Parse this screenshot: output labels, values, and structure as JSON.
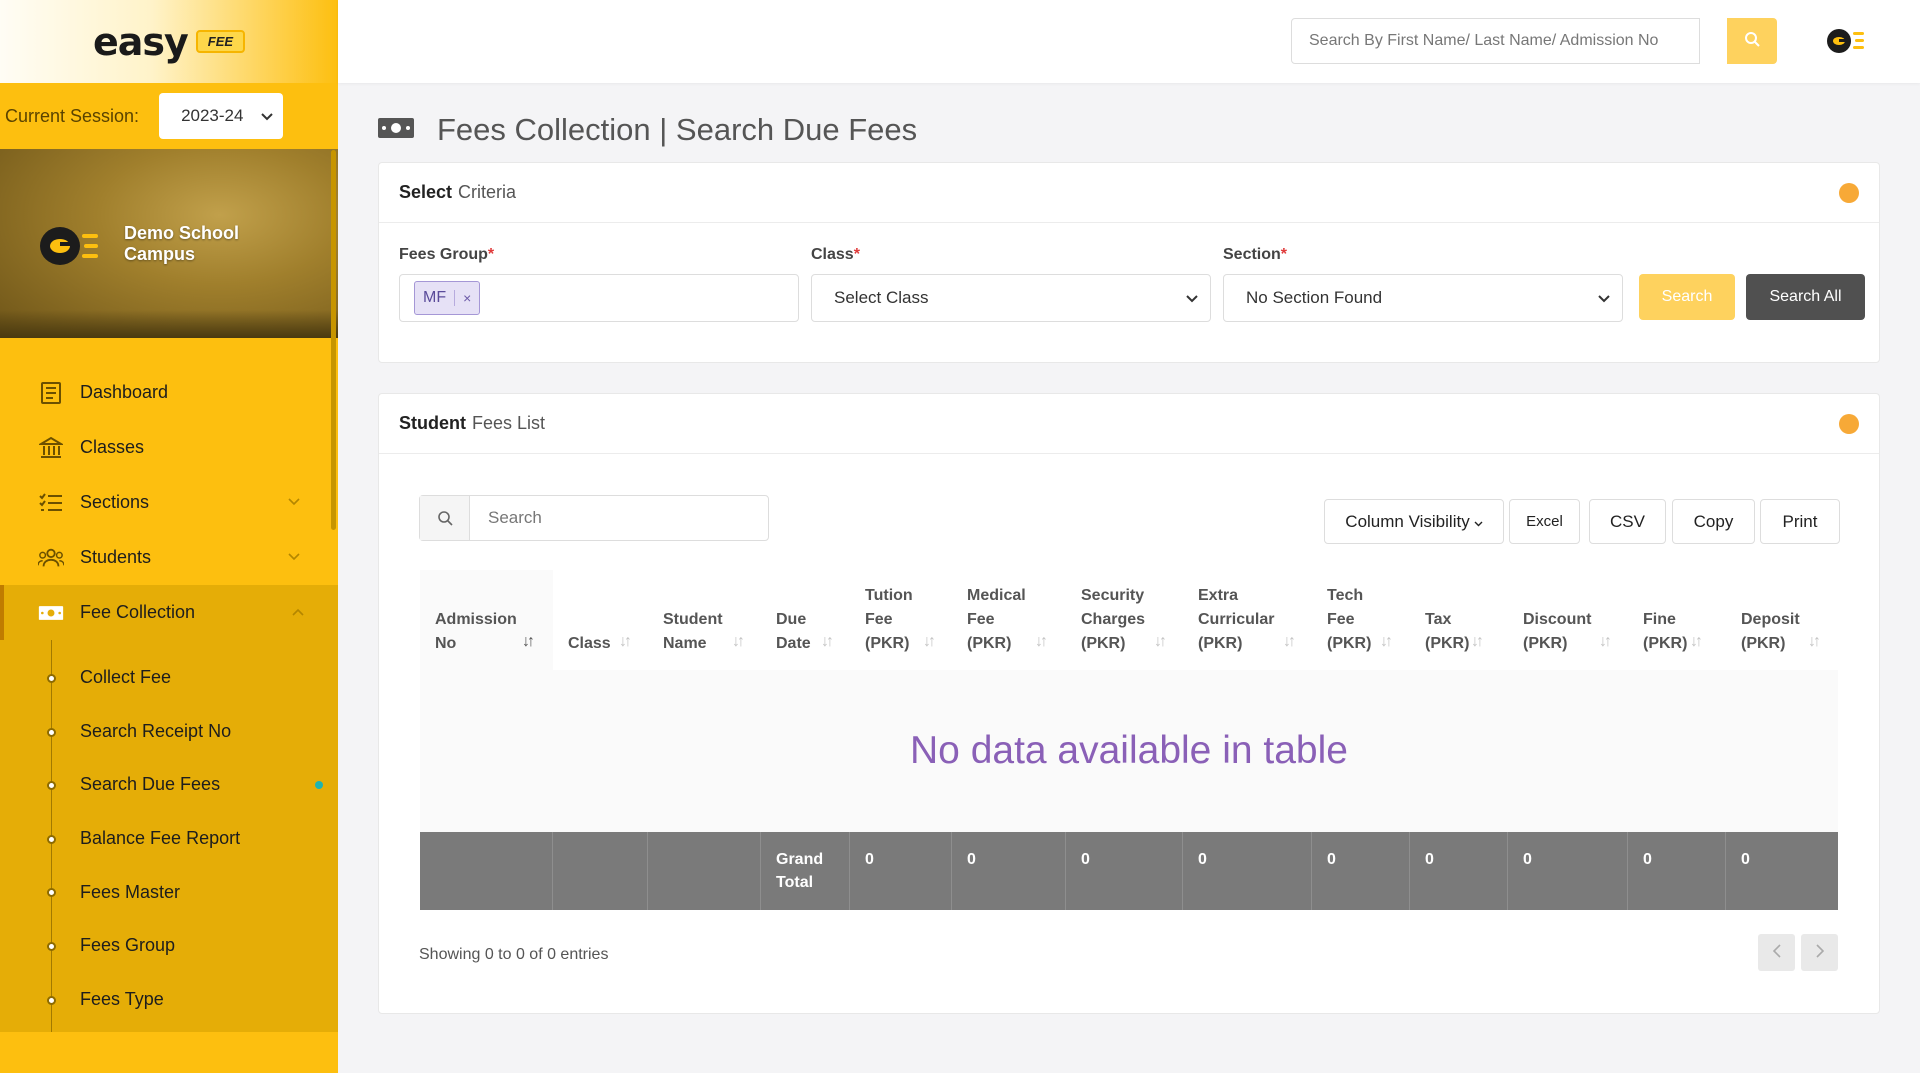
{
  "brand": {
    "logo_text": "easy",
    "logo_badge": "FEE"
  },
  "session": {
    "label": "Current Session:",
    "value": "2023-24"
  },
  "school": {
    "name_line1": "Demo School",
    "name_line2": "Campus"
  },
  "sidebar": {
    "items": [
      {
        "label": "Dashboard",
        "icon": "dashboard-icon"
      },
      {
        "label": "Classes",
        "icon": "bank-icon"
      },
      {
        "label": "Sections",
        "icon": "list-icon"
      },
      {
        "label": "Students",
        "icon": "users-icon"
      },
      {
        "label": "Fee Collection",
        "icon": "money-icon"
      }
    ],
    "subitems": [
      {
        "label": "Collect Fee"
      },
      {
        "label": "Search Receipt No"
      },
      {
        "label": "Search Due Fees"
      },
      {
        "label": "Balance Fee Report"
      },
      {
        "label": "Fees Master"
      },
      {
        "label": "Fees Group"
      },
      {
        "label": "Fees Type"
      }
    ]
  },
  "topbar": {
    "search_placeholder": "Search By First Name/ Last Name/ Admission No"
  },
  "page": {
    "title": "Fees Collection | Search Due Fees"
  },
  "criteria": {
    "header_bold": "Select",
    "header_rest": "Criteria",
    "fees_group_label": "Fees Group",
    "fees_group_tag": "MF",
    "tag_remove": "×",
    "class_label": "Class",
    "class_value": "Select Class",
    "section_label": "Section",
    "section_value": "No Section Found",
    "required_mark": "*",
    "search_button": "Search",
    "search_all_button": "Search All"
  },
  "list": {
    "header_bold": "Student",
    "header_rest": "Fees List",
    "search_placeholder": "Search",
    "buttons": {
      "column_visibility": "Column Visibility",
      "excel": "Excel",
      "csv": "CSV",
      "copy": "Copy",
      "print": "Print"
    },
    "columns": [
      "Admission\nNo",
      "Class",
      "Student\nName",
      "Due\nDate",
      "Tution\nFee\n(PKR)",
      "Medical\nFee\n(PKR)",
      "Security\nCharges\n(PKR)",
      "Extra\nCurricular\n(PKR)",
      "Tech\nFee\n(PKR)",
      "Tax\n(PKR)",
      "Discount\n(PKR)",
      "Fine\n(PKR)",
      "Deposit\n(PKR)"
    ],
    "empty_message": "No data available in table",
    "footer": {
      "grand_total_label": "Grand\nTotal",
      "totals": [
        "0",
        "0",
        "0",
        "0",
        "0",
        "0",
        "0",
        "0",
        "0"
      ]
    },
    "entries_text": "Showing 0 to 0 of 0 entries"
  },
  "colors": {
    "sidebar": "#fdbf0f",
    "accent": "#f7a937",
    "empty_text": "#8a60b7",
    "footer_bg": "#7a7a7a"
  }
}
